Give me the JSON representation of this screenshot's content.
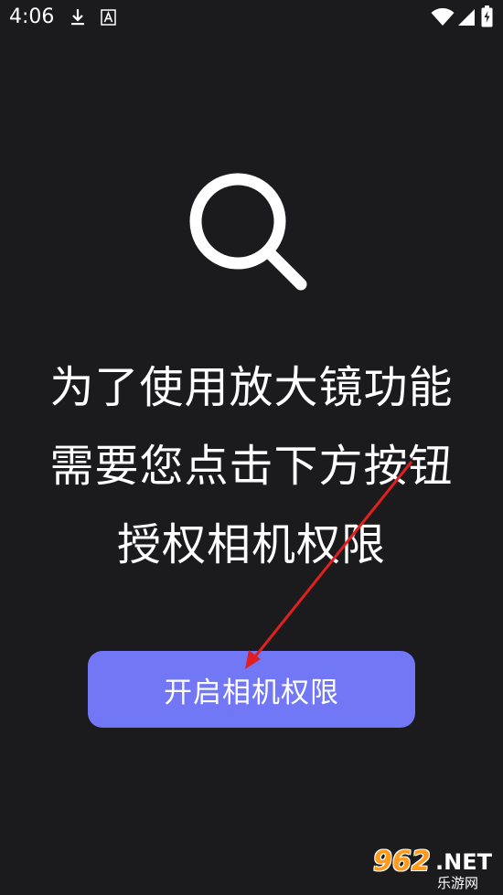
{
  "status_bar": {
    "time": "4:06",
    "icons": [
      "download-icon",
      "keyboard-a-icon",
      "wifi-icon",
      "signal-icon",
      "battery-charging-icon"
    ]
  },
  "hero_icon": "search-icon",
  "message": {
    "line1": "为了使用放大镜功能",
    "line2": "需要您点击下方按钮",
    "line3": "授权相机权限"
  },
  "grant_button": {
    "label": "开启相机权限"
  },
  "watermark": {
    "number": "962",
    "domain": ".NET",
    "subtitle": "乐游网"
  },
  "colors": {
    "background": "#1b1b1d",
    "button": "#7278f5",
    "text": "#ffffff",
    "arrow": "#e02020"
  }
}
